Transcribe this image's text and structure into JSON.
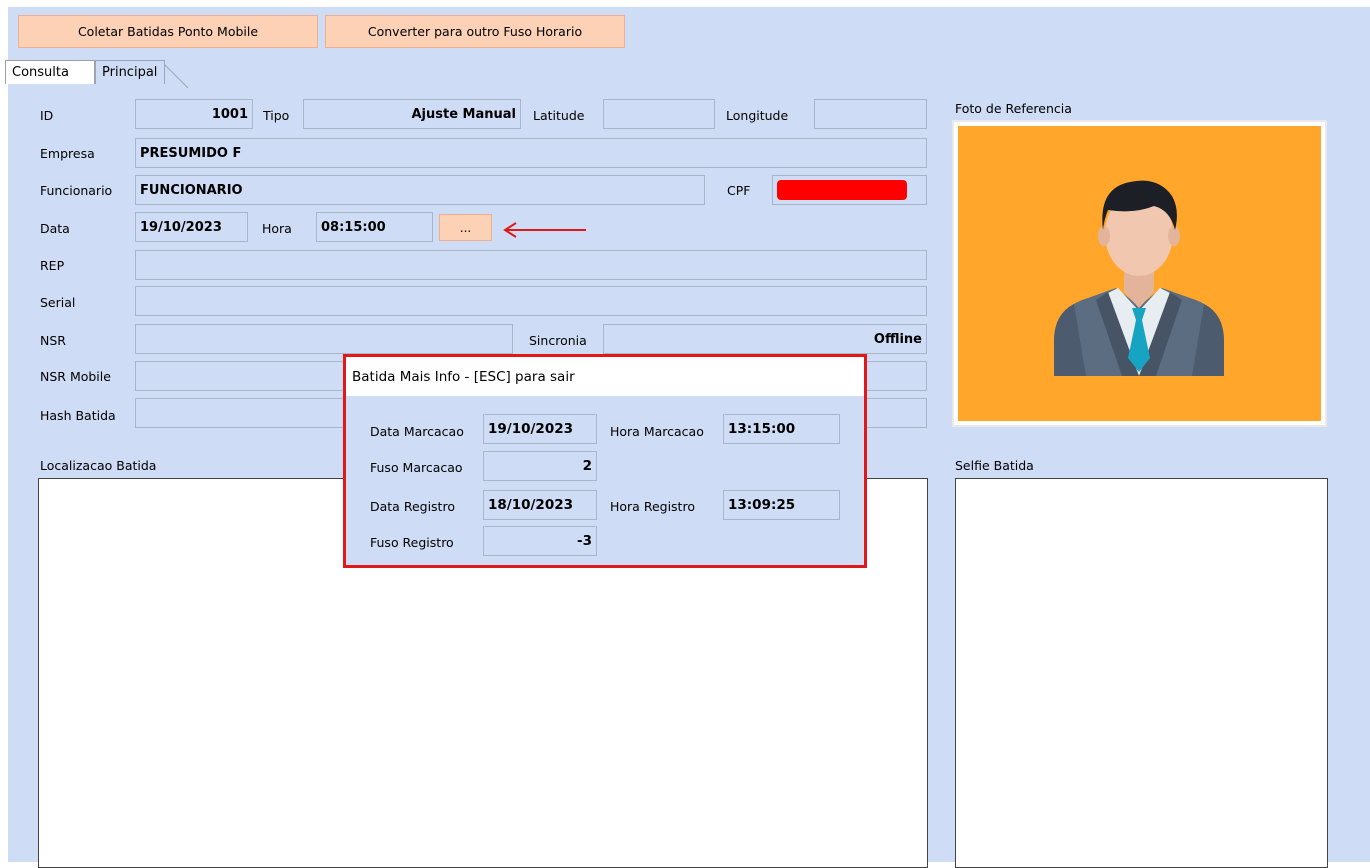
{
  "toolbar": {
    "collect_label": "Coletar Batidas Ponto Mobile",
    "convert_label": "Converter para outro Fuso Horario"
  },
  "tabs": [
    {
      "label": "Consulta"
    },
    {
      "label": "Principal"
    }
  ],
  "form": {
    "id_label": "ID",
    "id_value": "1001",
    "tipo_label": "Tipo",
    "tipo_value": "Ajuste Manual",
    "latitude_label": "Latitude",
    "latitude_value": "",
    "longitude_label": "Longitude",
    "longitude_value": "",
    "empresa_label": "Empresa",
    "empresa_value": "PRESUMIDO F",
    "funcionario_label": "Funcionario",
    "funcionario_value": "FUNCIONARIO",
    "cpf_label": "CPF",
    "data_label": "Data",
    "data_value": "19/10/2023",
    "hora_label": "Hora",
    "hora_value": "08:15:00",
    "more_button_label": "...",
    "rep_label": "REP",
    "rep_value": "",
    "serial_label": "Serial",
    "serial_value": "",
    "nsr_label": "NSR",
    "nsr_value": "",
    "sincronia_label": "Sincronia",
    "sincronia_value": "Offline",
    "nsr_mobile_label": "NSR Mobile",
    "nsr_mobile_value": "",
    "hash_label": "Hash Batida",
    "hash_value": ""
  },
  "panels": {
    "localizacao_label": "Localizacao Batida",
    "foto_label": "Foto de Referencia",
    "selfie_label": "Selfie Batida"
  },
  "dialog": {
    "title": "Batida Mais Info - [ESC] para sair",
    "data_marcacao_label": "Data Marcacao",
    "data_marcacao_value": "19/10/2023",
    "hora_marcacao_label": "Hora Marcacao",
    "hora_marcacao_value": "13:15:00",
    "fuso_marcacao_label": "Fuso Marcacao",
    "fuso_marcacao_value": "2",
    "data_registro_label": "Data Registro",
    "data_registro_value": "18/10/2023",
    "hora_registro_label": "Hora Registro",
    "hora_registro_value": "13:09:25",
    "fuso_registro_label": "Fuso Registro",
    "fuso_registro_value": "-3"
  },
  "colors": {
    "background": "#cedcf5",
    "button": "#fdd1b5",
    "redacted": "#ff0000",
    "dialog_border": "#e01818",
    "photo_background": "#ffa62b"
  }
}
